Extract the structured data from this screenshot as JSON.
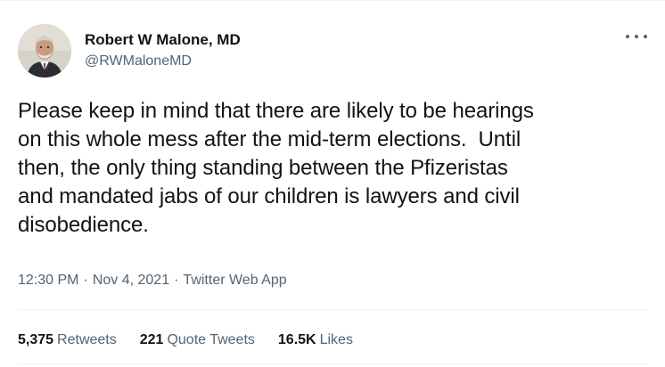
{
  "author": {
    "display_name": "Robert W Malone, MD",
    "handle": "@RWMaloneMD"
  },
  "tweet": {
    "text": "Please keep in mind that there are likely to be hearings\non this whole mess after the mid-term elections.  Until\nthen, the only thing standing between the Pfizeristas\nand mandated jabs of our children is lawyers and civil\ndisobedience.",
    "time": "12:30 PM",
    "date": "Nov 4, 2021",
    "source": "Twitter Web App",
    "separator": "·"
  },
  "stats": {
    "retweets_count": "5,375",
    "retweets_label": "Retweets",
    "quote_tweets_count": "221",
    "quote_tweets_label": "Quote Tweets",
    "likes_count": "16.5K",
    "likes_label": "Likes"
  },
  "icons": {
    "more": "more-options-icon"
  },
  "colors": {
    "text": "#0f1419",
    "secondary": "#536471",
    "divider": "#eff3f4"
  }
}
